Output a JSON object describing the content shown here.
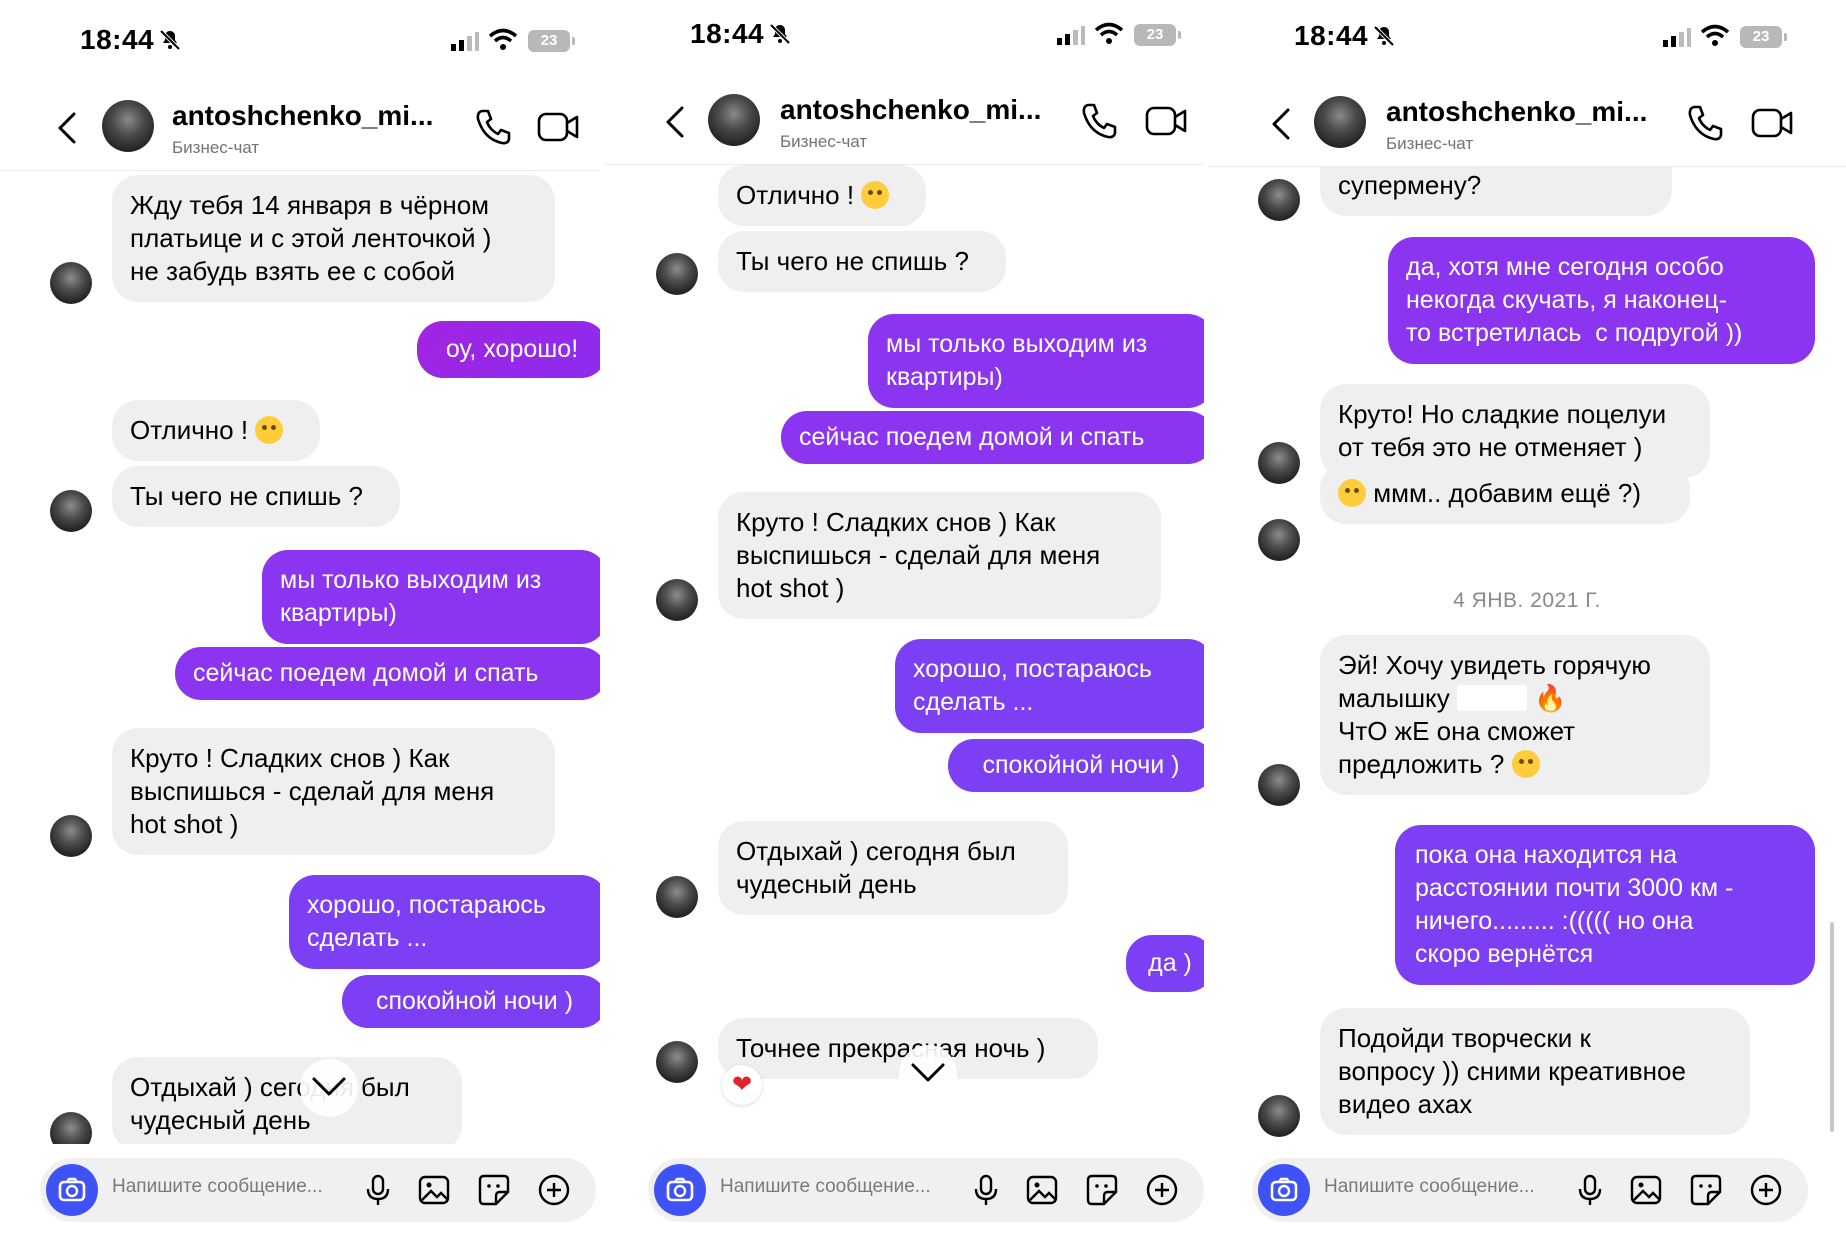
{
  "status": {
    "time": "18:44",
    "battery": "23"
  },
  "header": {
    "name": "antoshchenko_mi...",
    "subtitle": "Бизнес-чат"
  },
  "composer": {
    "placeholder": "Напишите сообщение..."
  },
  "colors": {
    "accent": "#7d3ff3",
    "camera": "#3f52f5",
    "incoming_bg": "#efefef"
  },
  "panel1": {
    "messages": [
      {
        "from": "them",
        "text": "Жду тебя 14 января в чёрном\nплатьице и с этой ленточкой )\nне забудь взять ее с собой"
      },
      {
        "from": "me",
        "text": "оу, хорошо!"
      },
      {
        "from": "them",
        "text": "Отлично !",
        "emoji": "smile"
      },
      {
        "from": "them",
        "text": "Ты чего не спишь ?"
      },
      {
        "from": "me",
        "text": "мы только выходим из\nквартиры)"
      },
      {
        "from": "me",
        "text": "сейчас поедем домой и спать"
      },
      {
        "from": "them",
        "text": "Круто ! Сладких снов ) Как\nвыспишься - сделай для меня\nhot shot )"
      },
      {
        "from": "me",
        "text": "хорошо, постараюсь\nсделать ..."
      },
      {
        "from": "me",
        "text": "спокойной ночи )"
      },
      {
        "from": "them",
        "text": "Отдыхай ) сегодня был\nчудесный день"
      }
    ]
  },
  "panel2": {
    "messages": [
      {
        "from": "them",
        "text": "Отлично !",
        "emoji": "smile"
      },
      {
        "from": "them",
        "text": "Ты чего не спишь ?"
      },
      {
        "from": "me",
        "text": "мы только выходим из\nквартиры)"
      },
      {
        "from": "me",
        "text": "сейчас поедем домой и спать"
      },
      {
        "from": "them",
        "text": "Круто ! Сладких снов ) Как\nвыспишься - сделай для меня\nhot shot )"
      },
      {
        "from": "me",
        "text": "хорошо, постараюсь\nсделать ..."
      },
      {
        "from": "me",
        "text": "спокойной ночи )"
      },
      {
        "from": "them",
        "text": "Отдыхай ) сегодня был\nчудесный день"
      },
      {
        "from": "me",
        "text": "да )"
      },
      {
        "from": "them",
        "text": "Точнее прекрасная ночь )",
        "reaction": "❤"
      }
    ]
  },
  "panel3": {
    "messages": [
      {
        "from": "them",
        "text": "супермену?"
      },
      {
        "from": "me",
        "text": "да, хотя мне сегодня особо\nнекогда скучать, я наконец-\nто встретилась  с подругой ))"
      },
      {
        "from": "them",
        "text": "Круто! Но сладкие поцелуи\nот тебя это не отменяет )"
      },
      {
        "from": "them",
        "text": "ммм.. добавим ещё ?)",
        "emoji": "smile"
      },
      {
        "from": "date",
        "text": "4 ЯНВ. 2021 Г."
      },
      {
        "from": "them",
        "line1": "Эй! Хочу увидеть горячую",
        "line2": "малышку",
        "line3": "ЧтО жЕ она сможет",
        "line4": "предложить ?",
        "emoji_fire": "🔥"
      },
      {
        "from": "me",
        "text": "пока она находится на\nрасстоянии почти 3000 км -\nничего......... :((((( но она\nскоро вернётся"
      },
      {
        "from": "them",
        "text": "Подойди творчески к\nвопросу )) сними креативное\nвидео ахах"
      }
    ]
  }
}
